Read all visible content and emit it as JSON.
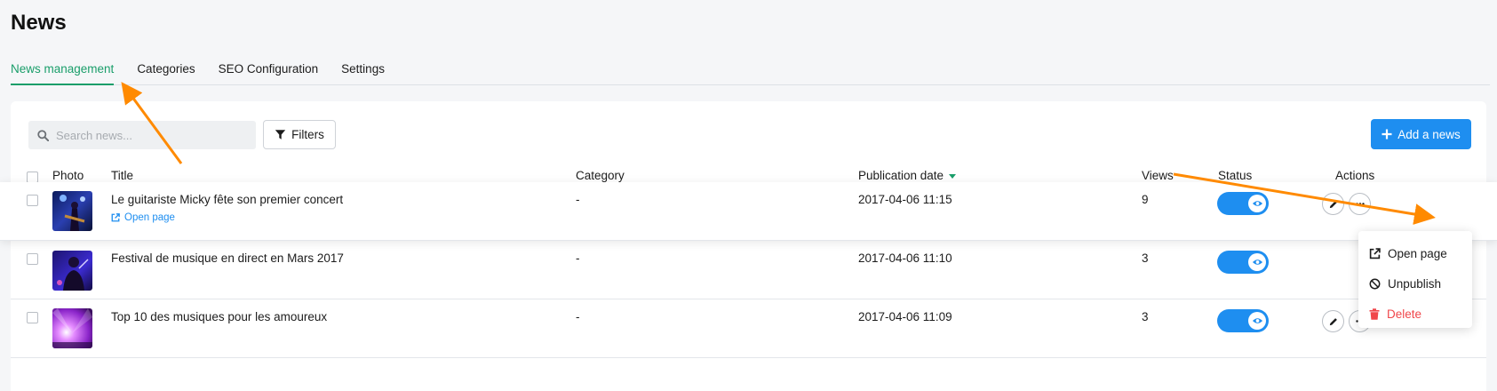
{
  "page": {
    "title": "News"
  },
  "tabs": [
    {
      "label": "News management",
      "active": true
    },
    {
      "label": "Categories",
      "active": false
    },
    {
      "label": "SEO Configuration",
      "active": false
    },
    {
      "label": "Settings",
      "active": false
    }
  ],
  "toolbar": {
    "search_placeholder": "Search news...",
    "filters_label": "Filters",
    "add_label": "Add a news"
  },
  "table": {
    "headers": {
      "photo": "Photo",
      "title": "Title",
      "category": "Category",
      "publication_date": "Publication date",
      "views": "Views",
      "status": "Status",
      "actions": "Actions"
    },
    "sorted_by": "publication_date",
    "rows": [
      {
        "title": "Le guitariste Micky fête son premier concert",
        "open_page_label": "Open page",
        "category": "-",
        "publication_date": "2017-04-06 11:15",
        "views": "9",
        "published": true,
        "thumb_icon": "guitarist-photo"
      },
      {
        "title": "Festival de musique en direct en Mars 2017",
        "category": "-",
        "publication_date": "2017-04-06 11:10",
        "views": "3",
        "published": true,
        "thumb_icon": "concert-photo"
      },
      {
        "title": "Top 10 des musiques pour les amoureux",
        "category": "-",
        "publication_date": "2017-04-06 11:09",
        "views": "3",
        "published": true,
        "thumb_icon": "stage-lights-photo"
      }
    ]
  },
  "actions_menu": {
    "items": [
      {
        "label": "Open page",
        "icon": "external-link-icon"
      },
      {
        "label": "Unpublish",
        "icon": "block-icon"
      },
      {
        "label": "Delete",
        "icon": "trash-icon"
      }
    ]
  },
  "colors": {
    "accent_green": "#1a9e6a",
    "primary_blue": "#1e8ef0",
    "danger_red": "#f0474b",
    "annotation_orange": "#ff8a00"
  }
}
